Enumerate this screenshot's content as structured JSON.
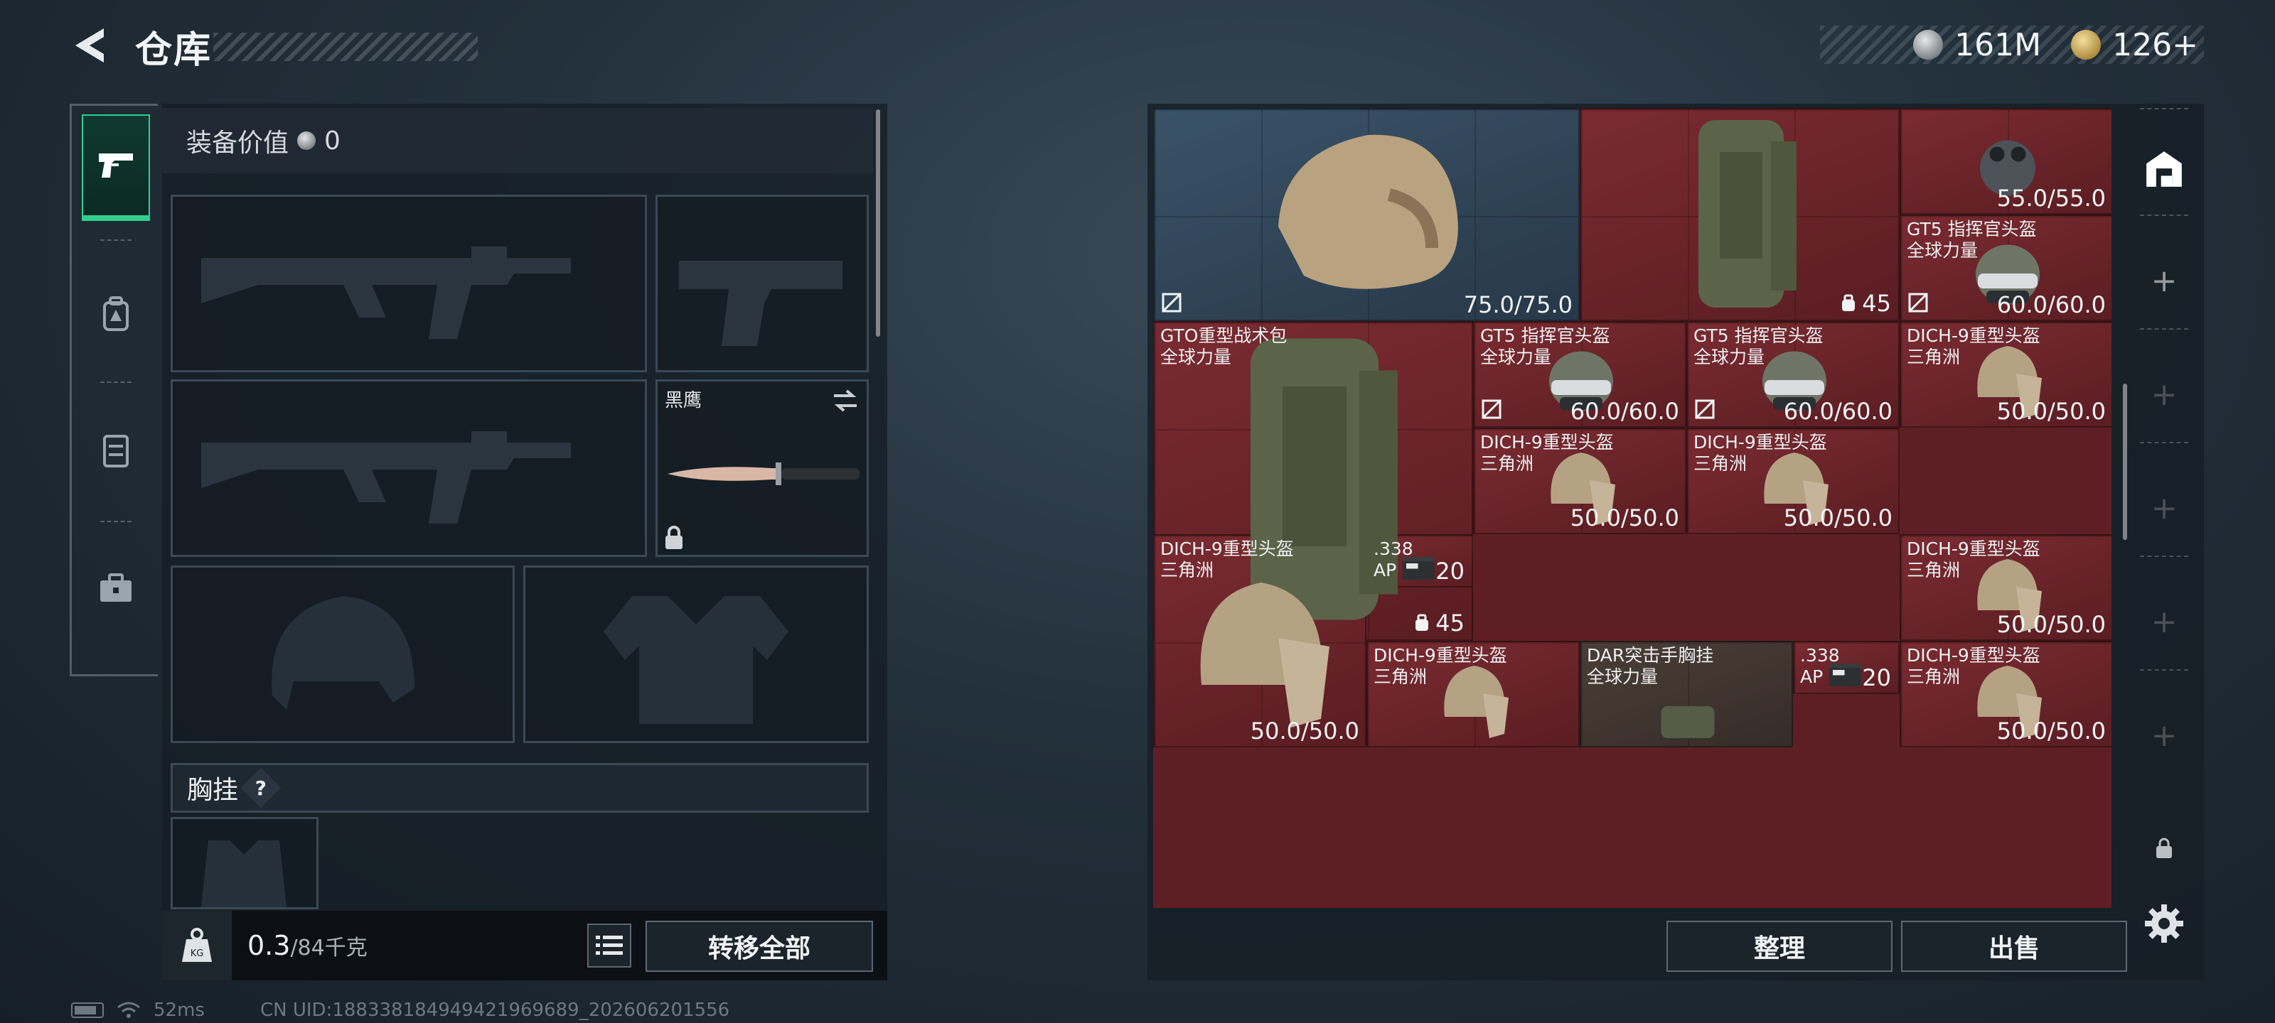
{
  "header": {
    "title": "仓库",
    "back_icon": "back-arrow-icon",
    "currency": [
      {
        "icon": "silver-coin-icon",
        "value": "161M"
      },
      {
        "icon": "gold-coin-icon",
        "value": "126+"
      }
    ]
  },
  "left_tabs": [
    {
      "icon": "pistol-icon",
      "active": true
    },
    {
      "icon": "backpack-icon",
      "active": false
    },
    {
      "icon": "chest-rig-icon",
      "active": false
    },
    {
      "icon": "toolbox-icon",
      "active": false
    }
  ],
  "loadout": {
    "value_label": "装备价值",
    "value": "0",
    "melee_name": "黑鹰",
    "chest_label": "胸挂",
    "help_label": "?",
    "weight_value": "0.3",
    "weight_max": "/84千克",
    "transfer_all": "转移全部"
  },
  "storage": {
    "items": [
      {
        "name": "",
        "sub": "",
        "value": "75.0/75.0",
        "kind": "durability",
        "color": "blue",
        "mark": true
      },
      {
        "name": "",
        "sub": "",
        "value": "45",
        "kind": "capacity",
        "color": "red",
        "mark": false
      },
      {
        "name": "",
        "sub": "",
        "value": "55.0/55.0",
        "kind": "durability",
        "color": "red",
        "mark": false
      },
      {
        "name": "GT5 指挥官头盔",
        "sub": "全球力量",
        "value": "60.0/60.0",
        "kind": "durability",
        "color": "red",
        "mark": true
      },
      {
        "name": "GTO重型战术包",
        "sub": "全球力量",
        "value": "45",
        "kind": "capacity",
        "color": "red",
        "mark": false
      },
      {
        "name": "GT5 指挥官头盔",
        "sub": "全球力量",
        "value": "60.0/60.0",
        "kind": "durability",
        "color": "red",
        "mark": true
      },
      {
        "name": "GT5 指挥官头盔",
        "sub": "全球力量",
        "value": "60.0/60.0",
        "kind": "durability",
        "color": "red",
        "mark": true
      },
      {
        "name": "DICH-9重型头盔",
        "sub": "三角洲",
        "value": "50.0/50.0",
        "kind": "durability",
        "color": "red",
        "mark": false
      },
      {
        "name": "DICH-9重型头盔",
        "sub": "三角洲",
        "value": "50.0/50.0",
        "kind": "durability",
        "color": "red",
        "mark": false
      },
      {
        "name": "DICH-9重型头盔",
        "sub": "三角洲",
        "value": "50.0/50.0",
        "kind": "durability",
        "color": "red",
        "mark": false
      },
      {
        "name": "DICH-9重型头盔",
        "sub": "三角洲",
        "value": "50.0/50.0",
        "kind": "durability",
        "color": "red",
        "mark": false
      },
      {
        "name": ".338",
        "sub": "AP",
        "value": "20",
        "kind": "count",
        "color": "red",
        "mark": false
      },
      {
        "name": "DICH-9重型头盔",
        "sub": "三角洲",
        "value": "50.0/50.0",
        "kind": "durability",
        "color": "red",
        "mark": false
      },
      {
        "name": "DICH-9重型头盔",
        "sub": "三角洲",
        "value": "",
        "kind": "durability",
        "color": "red",
        "mark": false
      },
      {
        "name": "DAR突击手胸挂",
        "sub": "全球力量",
        "value": "",
        "kind": "none",
        "color": "grey",
        "mark": false
      },
      {
        "name": ".338",
        "sub": "AP",
        "value": "20",
        "kind": "count",
        "color": "red",
        "mark": false
      },
      {
        "name": "DICH-9重型头盔",
        "sub": "三角洲",
        "value": "50.0/50.0",
        "kind": "durability",
        "color": "red",
        "mark": false
      }
    ],
    "sort_label": "整理",
    "sell_label": "出售"
  },
  "side_rail": {
    "icons": [
      "stash-icon",
      "plus-icon",
      "plus-icon",
      "plus-icon",
      "plus-icon",
      "plus-icon",
      "lock-icon",
      "settings-gear-icon"
    ]
  },
  "status_bar": {
    "ping": "52ms",
    "uid": "CN UID:1883381849494219696​89_202606201556"
  },
  "colors": {
    "accent_green": "#2fd08e",
    "cell_red": "#7a2b31",
    "cell_blue": "#3a5267"
  }
}
